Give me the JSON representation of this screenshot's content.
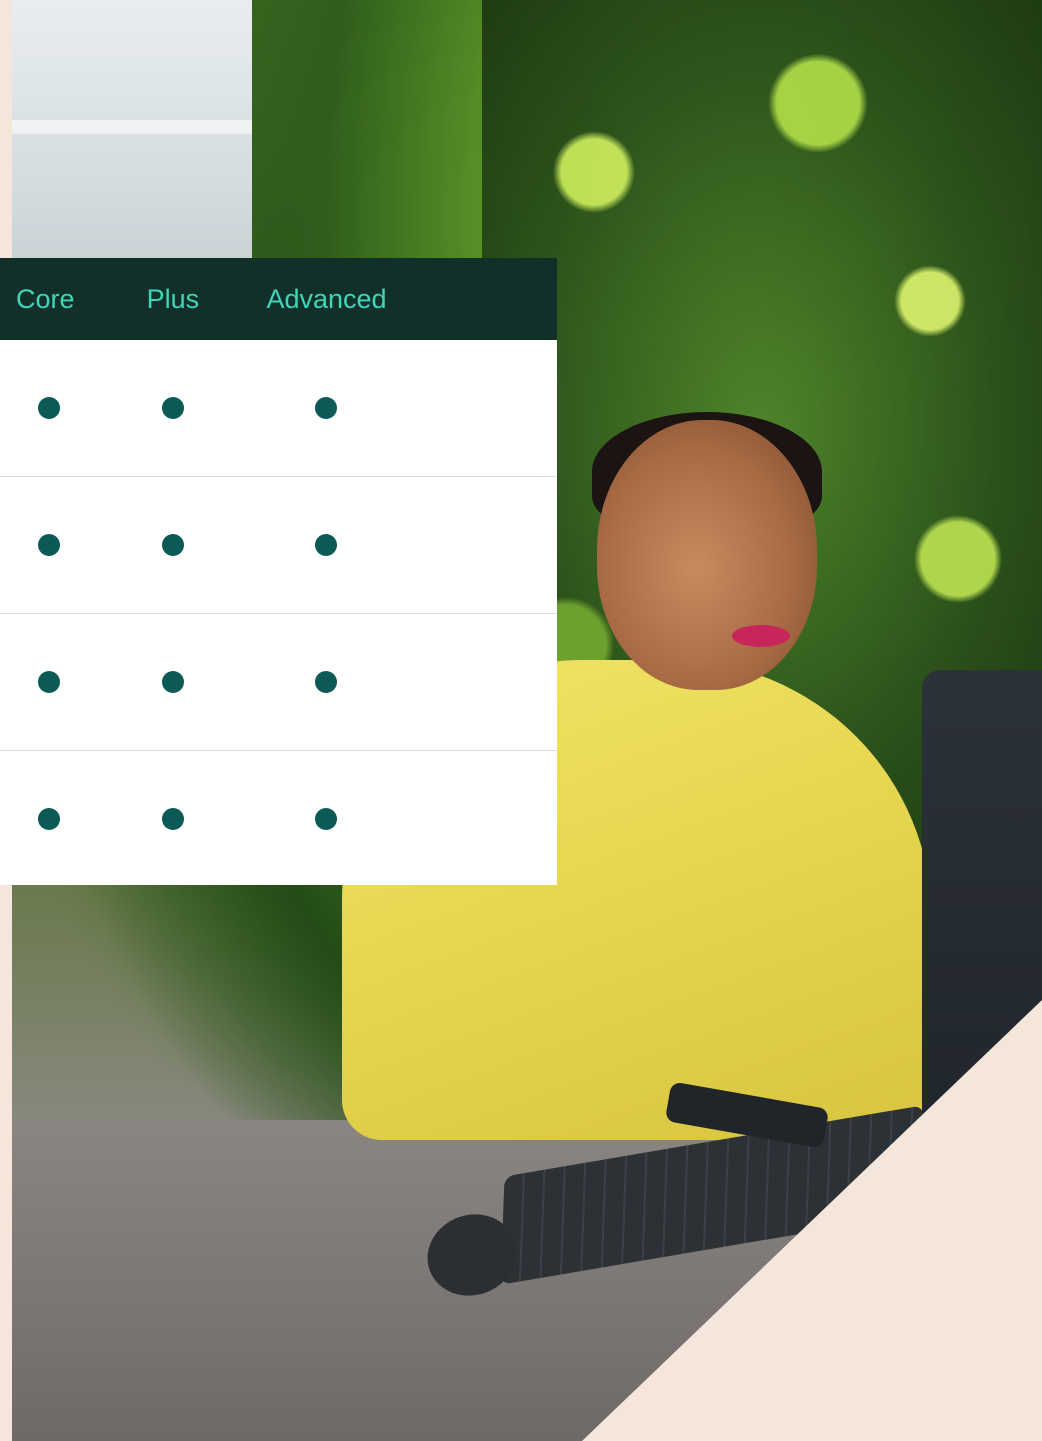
{
  "plan_table": {
    "columns": [
      "Core",
      "Plus",
      "Advanced"
    ],
    "rows": [
      {
        "core": true,
        "plus": true,
        "advanced": true
      },
      {
        "core": true,
        "plus": true,
        "advanced": true
      },
      {
        "core": true,
        "plus": true,
        "advanced": true
      },
      {
        "core": true,
        "plus": true,
        "advanced": true
      }
    ]
  },
  "colors": {
    "header_bg": "#113029",
    "header_text": "#3fd6b7",
    "dot": "#0b5a56",
    "page_bg": "#f5e6dc"
  },
  "icons": {
    "included": "filled-dot-icon"
  }
}
